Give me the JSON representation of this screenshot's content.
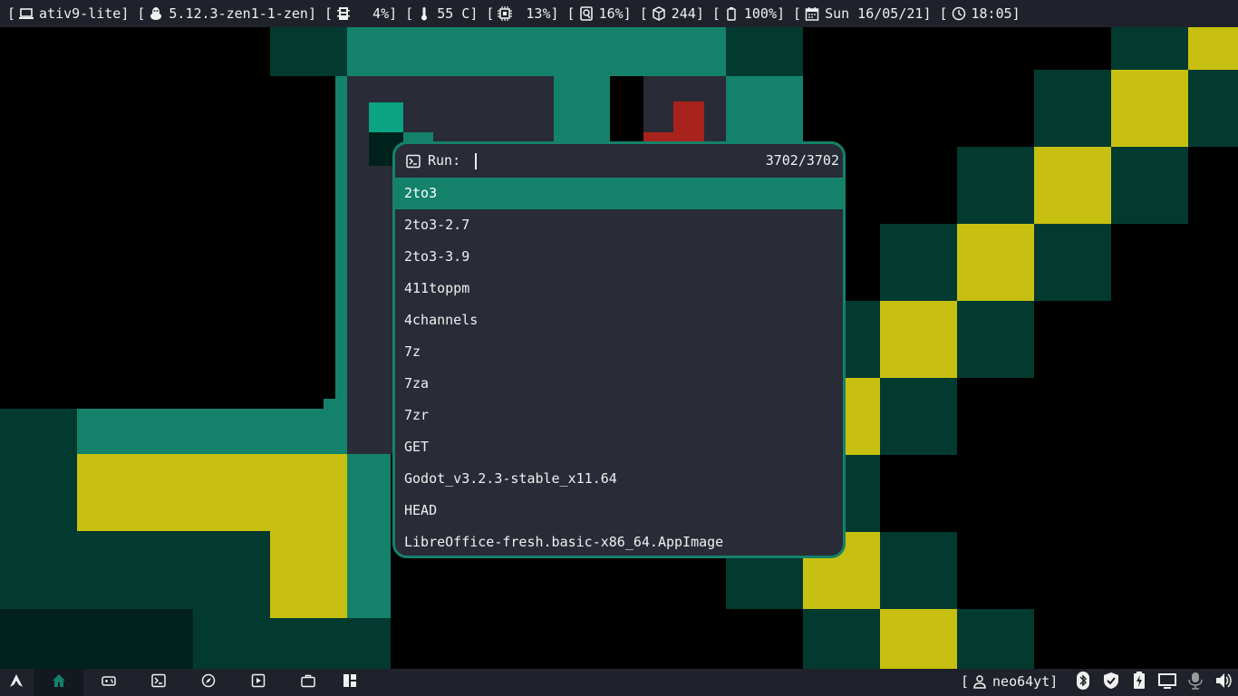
{
  "topbar": {
    "host": "ativ9-lite",
    "kernel": "5.12.3-zen1-1-zen",
    "memory": "  4%",
    "temperature": "55 C",
    "cpu": " 13%",
    "disk": "16%",
    "packages": "244",
    "battery": "100%",
    "date": "Sun 16/05/21",
    "time": "18:05",
    "icons": [
      "laptop-icon",
      "linux-icon",
      "memory-icon",
      "thermometer-icon",
      "cpu-icon",
      "disk-icon",
      "package-icon",
      "battery-icon",
      "calendar-icon",
      "clock-icon"
    ]
  },
  "launcher": {
    "prompt_label": "Run:",
    "prompt_value": "",
    "count": "3702/3702",
    "results": [
      "2to3",
      "2to3-2.7",
      "2to3-3.9",
      "411toppm",
      "4channels",
      "7z",
      "7za",
      "7zr",
      "GET",
      "Godot_v3.2.3-stable_x11.64",
      "HEAD",
      "LibreOffice-fresh.basic-x86_64.AppImage"
    ],
    "selected_index": 0
  },
  "bottombar": {
    "workspaces": [
      "arch-icon",
      "home-icon",
      "gamepad-icon",
      "terminal-icon",
      "compass-icon",
      "play-icon",
      "briefcase-icon",
      "layout-icon"
    ],
    "active_workspace": 1,
    "user": "neo64yt",
    "tray": [
      "bluetooth-icon",
      "shield-icon",
      "power-icon",
      "display-icon",
      "microphone-icon",
      "volume-icon"
    ]
  },
  "colors": {
    "accent": "#14826b",
    "dark_green": "#033a30",
    "yellow": "#c8c010",
    "panel": "#292b36",
    "bar": "#1f222a",
    "red": "#a8221c"
  }
}
